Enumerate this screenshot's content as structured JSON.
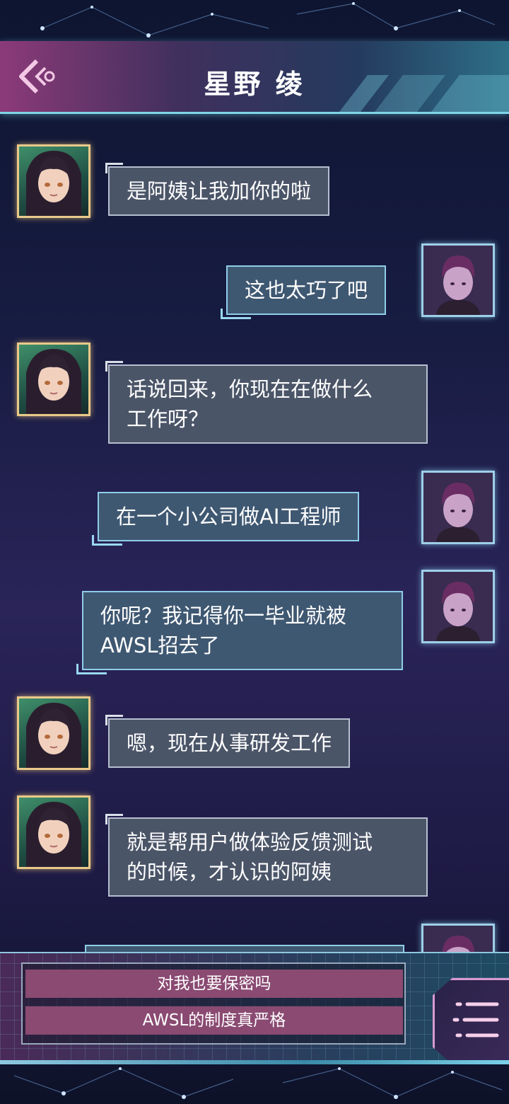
{
  "header": {
    "title": "星野 绫",
    "back_icon": "chevron-left-icon"
  },
  "messages": [
    {
      "sender": "her",
      "text": "是阿姨让我加你的啦"
    },
    {
      "sender": "me",
      "text": "这也太巧了吧"
    },
    {
      "sender": "her",
      "lines": [
        "话说回来，你现在在做什么",
        "工作呀？"
      ]
    },
    {
      "sender": "me",
      "text": "在一个小公司做AI工程师"
    },
    {
      "sender": "me",
      "lines": [
        "你呢？我记得你一毕业就被",
        "AWSL招去了"
      ]
    },
    {
      "sender": "her",
      "text": "嗯，现在从事研发工作"
    },
    {
      "sender": "her",
      "lines": [
        "就是帮用户做体验反馈测试",
        "的时候，才认识的阿姨"
      ]
    }
  ],
  "reply_options": [
    {
      "label": "对我也要保密吗"
    },
    {
      "label": "AWSL的制度真严格"
    }
  ],
  "menu_icon": "menu-list-icon",
  "colors": {
    "her_bubble": "#4b5568",
    "me_bubble": "#3f5872",
    "option_bg": "#8a4a72",
    "accent": "#7fd6e8"
  }
}
